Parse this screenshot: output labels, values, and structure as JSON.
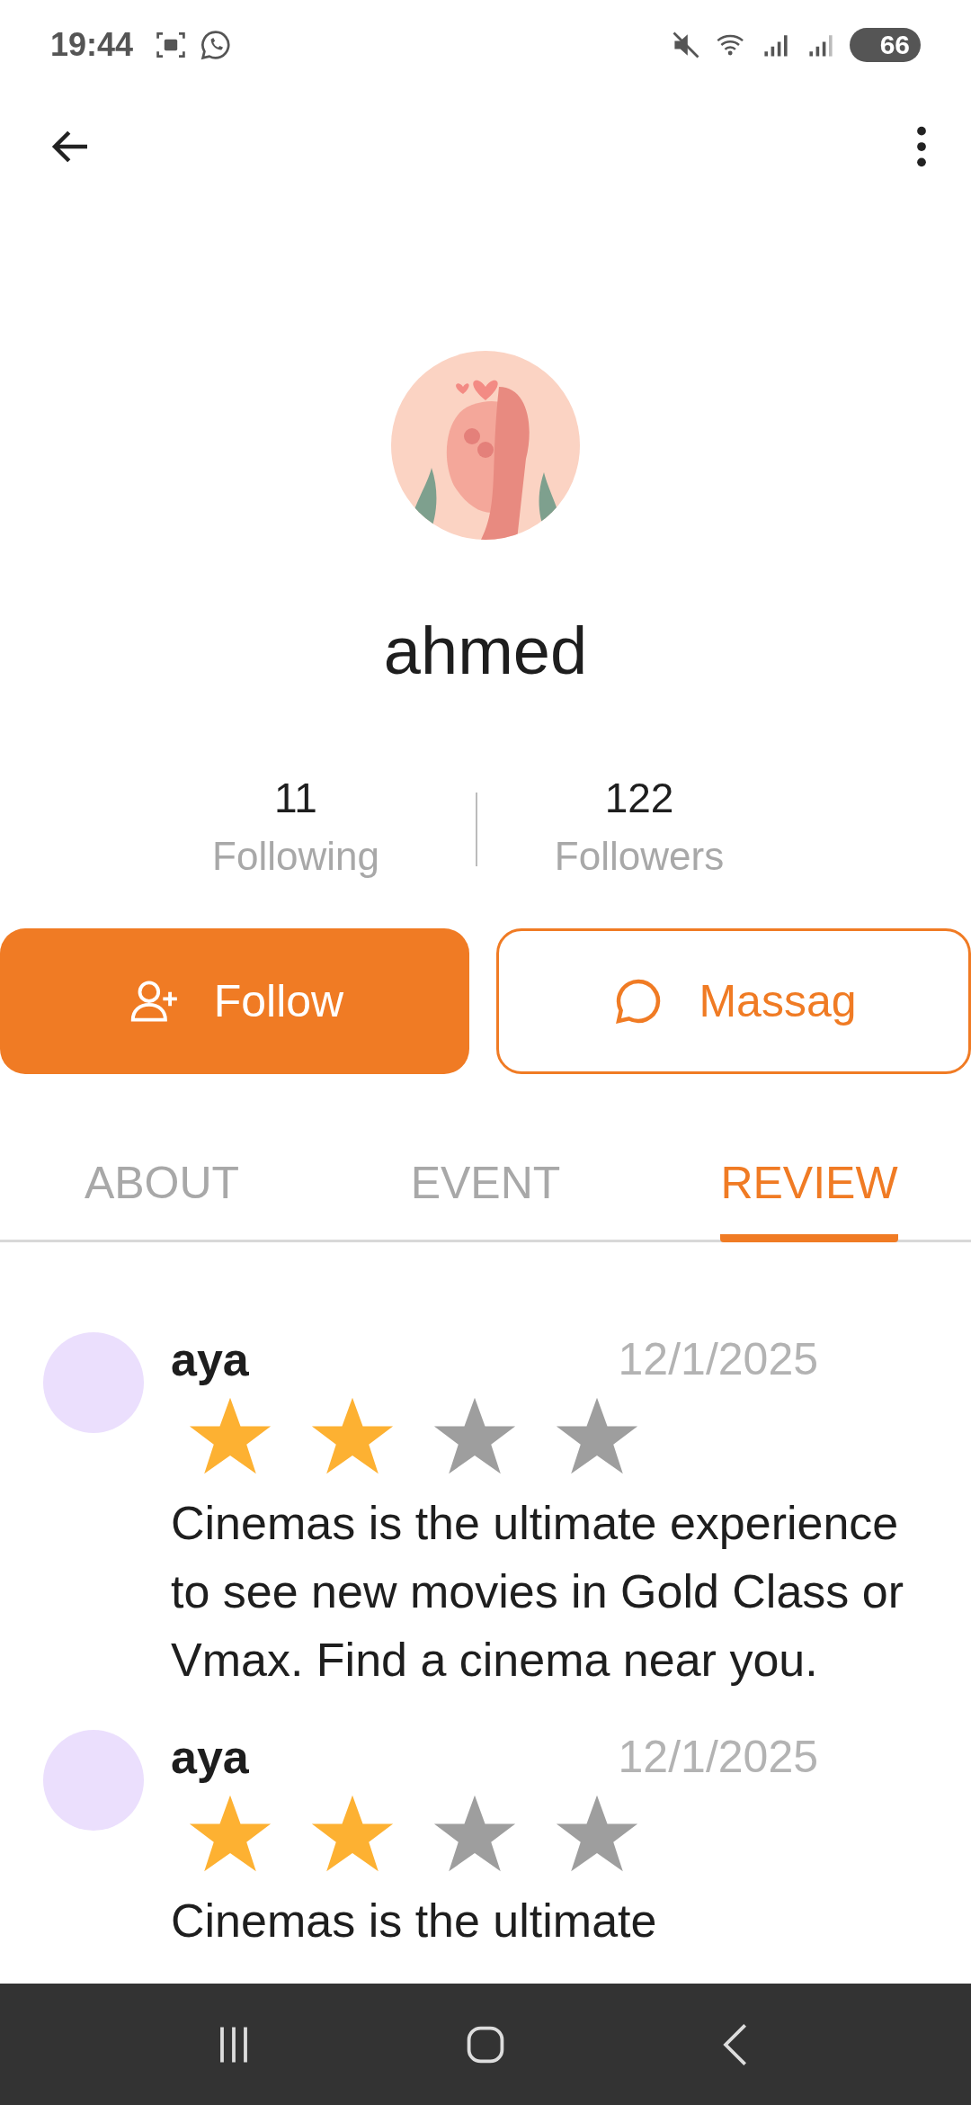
{
  "status_bar": {
    "time": "19:44",
    "battery": "66"
  },
  "profile": {
    "name": "ahmed"
  },
  "stats": [
    {
      "value": "11",
      "label": "Following"
    },
    {
      "value": "122",
      "label": "Followers"
    }
  ],
  "actions": [
    {
      "kind": "follow",
      "label": "Follow"
    },
    {
      "kind": "message",
      "label": "Massag"
    }
  ],
  "tabs": [
    {
      "label": "ABOUT",
      "selected": false
    },
    {
      "label": "EVENT",
      "selected": false
    },
    {
      "label": "REVIEW",
      "selected": true
    }
  ],
  "reviews": [
    {
      "name": "aya",
      "date": "12/1/2025",
      "stars": 2,
      "text": "Cinemas is the ultimate experience to see new movies in Gold Class or Vmax. Find a cinema near you."
    },
    {
      "name": "aya",
      "date": "12/1/2025",
      "stars": 2,
      "text": "Cinemas is the ultimate"
    }
  ]
}
